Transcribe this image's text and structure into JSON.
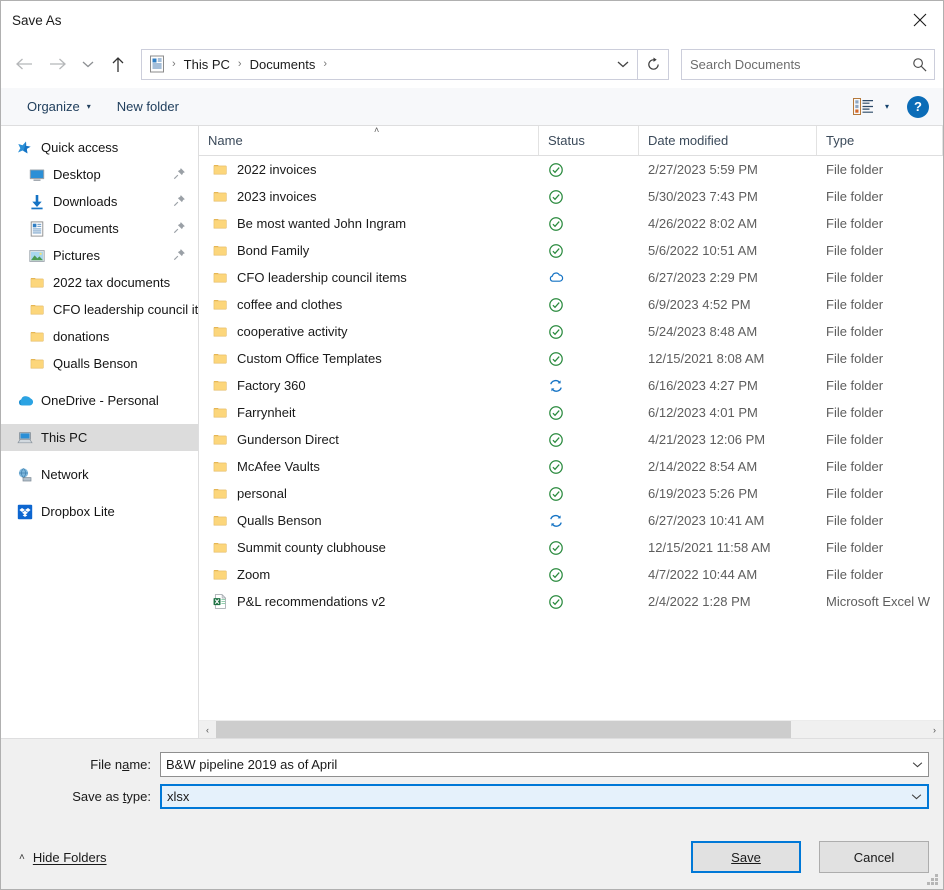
{
  "window": {
    "title": "Save As",
    "close_label": "Close"
  },
  "addressbar": {
    "back_icon": "arrow-left-icon",
    "forward_icon": "arrow-right-icon",
    "recent_icon": "chevron-down-icon",
    "up_icon": "arrow-up-icon",
    "path_icon": "documents-icon",
    "crumbs": [
      "This PC",
      "Documents"
    ],
    "separator": "›",
    "dropdown_icon": "chevron-down-icon",
    "refresh_icon": "refresh-icon"
  },
  "search": {
    "placeholder": "Search Documents",
    "value": "",
    "icon": "search-icon"
  },
  "commandbar": {
    "organize_label": "Organize",
    "organize_caret": "▾",
    "new_folder_label": "New folder",
    "view_icon": "view-details-icon",
    "view_caret": "▾",
    "help_label": "?"
  },
  "navpane": {
    "items": [
      {
        "label": "Quick access",
        "icon": "quick-access-star-icon",
        "level": "root",
        "pinned": false,
        "selected": false
      },
      {
        "label": "Desktop",
        "icon": "desktop-icon",
        "level": "sub",
        "pinned": true,
        "selected": false
      },
      {
        "label": "Downloads",
        "icon": "downloads-icon",
        "level": "sub",
        "pinned": true,
        "selected": false
      },
      {
        "label": "Documents",
        "icon": "documents-icon",
        "level": "sub",
        "pinned": true,
        "selected": false
      },
      {
        "label": "Pictures",
        "icon": "pictures-icon",
        "level": "sub",
        "pinned": true,
        "selected": false
      },
      {
        "label": "2022 tax documents",
        "icon": "folder-icon",
        "level": "sub",
        "pinned": false,
        "selected": false
      },
      {
        "label": "CFO leadership council items",
        "icon": "folder-icon",
        "level": "sub",
        "pinned": false,
        "selected": false
      },
      {
        "label": "donations",
        "icon": "folder-icon",
        "level": "sub",
        "pinned": false,
        "selected": false
      },
      {
        "label": "Qualls Benson",
        "icon": "folder-icon",
        "level": "sub",
        "pinned": false,
        "selected": false
      },
      {
        "label": "OneDrive - Personal",
        "icon": "onedrive-icon",
        "level": "root",
        "pinned": false,
        "selected": false,
        "gap_before": true
      },
      {
        "label": "This PC",
        "icon": "this-pc-icon",
        "level": "root",
        "pinned": false,
        "selected": true,
        "gap_before": true
      },
      {
        "label": "Network",
        "icon": "network-icon",
        "level": "root",
        "pinned": false,
        "selected": false,
        "gap_before": true
      },
      {
        "label": "Dropbox Lite",
        "icon": "dropbox-icon",
        "level": "root",
        "pinned": false,
        "selected": false,
        "gap_before": true
      }
    ]
  },
  "filelist": {
    "columns": [
      "Name",
      "Status",
      "Date modified",
      "Type"
    ],
    "sort_column": "Name",
    "sort_direction": "ascending",
    "sort_caret": "˄",
    "rows": [
      {
        "name": "2022 invoices",
        "icon": "folder-icon",
        "status": "synced",
        "date": "2/27/2023 5:59 PM",
        "type": "File folder"
      },
      {
        "name": "2023 invoices",
        "icon": "folder-icon",
        "status": "synced",
        "date": "5/30/2023 7:43 PM",
        "type": "File folder"
      },
      {
        "name": "Be most wanted John Ingram",
        "icon": "folder-icon",
        "status": "synced",
        "date": "4/26/2022 8:02 AM",
        "type": "File folder"
      },
      {
        "name": "Bond Family",
        "icon": "folder-icon",
        "status": "synced",
        "date": "5/6/2022 10:51 AM",
        "type": "File folder"
      },
      {
        "name": "CFO leadership council items",
        "icon": "folder-icon",
        "status": "online-only",
        "date": "6/27/2023 2:29 PM",
        "type": "File folder"
      },
      {
        "name": "coffee and clothes",
        "icon": "folder-icon",
        "status": "synced",
        "date": "6/9/2023 4:52 PM",
        "type": "File folder"
      },
      {
        "name": "cooperative activity",
        "icon": "folder-icon",
        "status": "synced",
        "date": "5/24/2023 8:48 AM",
        "type": "File folder"
      },
      {
        "name": "Custom Office Templates",
        "icon": "folder-icon",
        "status": "synced",
        "date": "12/15/2021 8:08 AM",
        "type": "File folder"
      },
      {
        "name": "Factory 360",
        "icon": "folder-icon",
        "status": "syncing",
        "date": "6/16/2023 4:27 PM",
        "type": "File folder"
      },
      {
        "name": "Farrynheit",
        "icon": "folder-icon",
        "status": "synced",
        "date": "6/12/2023 4:01 PM",
        "type": "File folder"
      },
      {
        "name": "Gunderson Direct",
        "icon": "folder-icon",
        "status": "synced",
        "date": "4/21/2023 12:06 PM",
        "type": "File folder"
      },
      {
        "name": "McAfee Vaults",
        "icon": "folder-icon",
        "status": "synced",
        "date": "2/14/2022 8:54 AM",
        "type": "File folder"
      },
      {
        "name": "personal",
        "icon": "folder-icon",
        "status": "synced",
        "date": "6/19/2023 5:26 PM",
        "type": "File folder"
      },
      {
        "name": "Qualls Benson",
        "icon": "folder-icon",
        "status": "syncing",
        "date": "6/27/2023 10:41 AM",
        "type": "File folder"
      },
      {
        "name": "Summit county clubhouse",
        "icon": "folder-icon",
        "status": "synced",
        "date": "12/15/2021 11:58 AM",
        "type": "File folder"
      },
      {
        "name": "Zoom",
        "icon": "folder-icon",
        "status": "synced",
        "date": "4/7/2022 10:44 AM",
        "type": "File folder"
      },
      {
        "name": "P&L recommendations v2",
        "icon": "excel-file-icon",
        "status": "synced",
        "date": "2/4/2022 1:28 PM",
        "type": "Microsoft Excel W"
      }
    ],
    "hscrollbar": {
      "left_arrow": "‹",
      "right_arrow": "›",
      "thumb_left_pct": 0,
      "thumb_width_pct": 81
    }
  },
  "form": {
    "file_name_label": "File name:",
    "file_name_accel": "n",
    "file_name_value": "B&W pipeline 2019 as of April",
    "save_as_type_label": "Save as type:",
    "save_as_type_accel": "t",
    "save_as_type_value": "xlsx",
    "caret_icon": "chevron-down-icon",
    "focused_field": "save_as_type"
  },
  "footer": {
    "hide_folders_label": "Hide Folders",
    "hide_folders_caret": "˄",
    "save_label": "Save",
    "save_accel": "S",
    "cancel_label": "Cancel",
    "resize_grip": "resize-grip-icon"
  },
  "colors": {
    "accent": "#0078d7",
    "status_synced": "#2a8a3e",
    "status_cloud": "#1573c4",
    "status_sync": "#1573c4",
    "folder_yellow": "#fcd67b",
    "excel_green": "#1f7244",
    "selection_gray": "#dcdcdc",
    "chrome_gray": "#f0f0f0"
  }
}
